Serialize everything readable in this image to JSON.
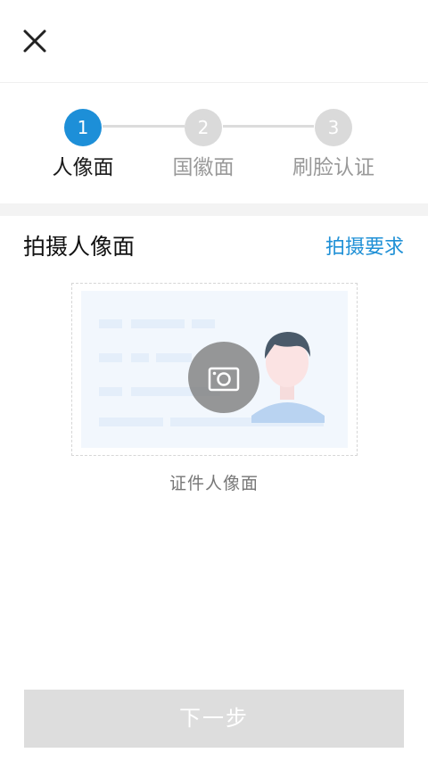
{
  "header": {
    "close_icon": "close-icon"
  },
  "steps": [
    {
      "number": "1",
      "label": "人像面",
      "active": true
    },
    {
      "number": "2",
      "label": "国徽面",
      "active": false
    },
    {
      "number": "3",
      "label": "刷脸认证",
      "active": false
    }
  ],
  "section": {
    "title": "拍摄人像面",
    "requirements_link": "拍摄要求"
  },
  "card": {
    "camera_icon": "camera-icon",
    "caption": "证件人像面"
  },
  "footer": {
    "next_label": "下一步"
  },
  "colors": {
    "accent": "#1d8fd8",
    "link": "#1f90d6",
    "inactive_step": "#dadada",
    "button_disabled": "#dddddd"
  }
}
